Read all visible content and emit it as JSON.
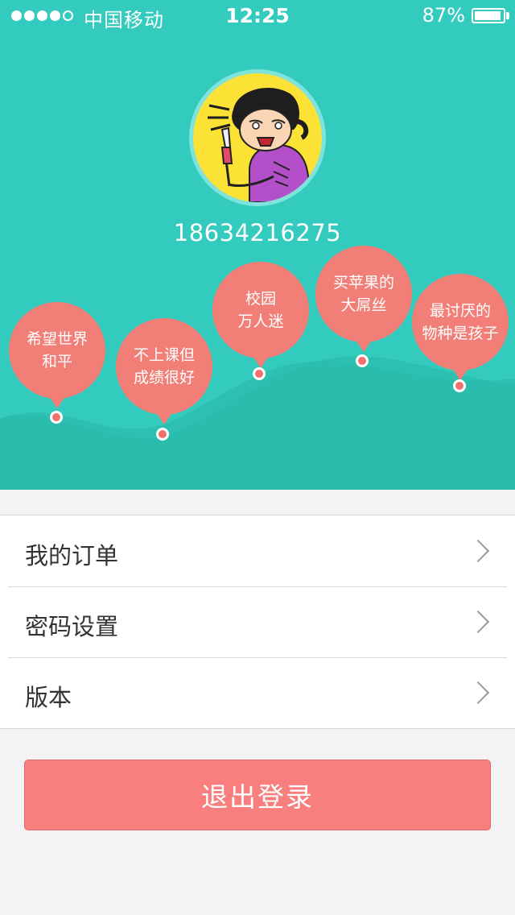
{
  "status_bar": {
    "carrier": "中国移动",
    "time": "12:25",
    "battery": "87%",
    "battery_level": 0.87,
    "signal_bars_filled": 4,
    "signal_bars_total": 5
  },
  "profile": {
    "phone": "18634216275",
    "avatar_icon": "cartoon-girl-with-knife-avatar"
  },
  "bubbles": [
    {
      "text": "希望世界\n和平"
    },
    {
      "text": "不上课但\n成绩很好"
    },
    {
      "text": "校园\n万人迷"
    },
    {
      "text": "买苹果的\n大屌丝"
    },
    {
      "text": "最讨厌的\n物种是孩子"
    }
  ],
  "menu": {
    "items": [
      {
        "label": "我的订单"
      },
      {
        "label": "密码设置"
      },
      {
        "label": "版本"
      }
    ]
  },
  "logout": {
    "label": "退出登录"
  },
  "colors": {
    "header": "#32cbbd",
    "bubble": "#f17f78",
    "logout": "#f87f7e",
    "background": "#f3f3f5"
  }
}
